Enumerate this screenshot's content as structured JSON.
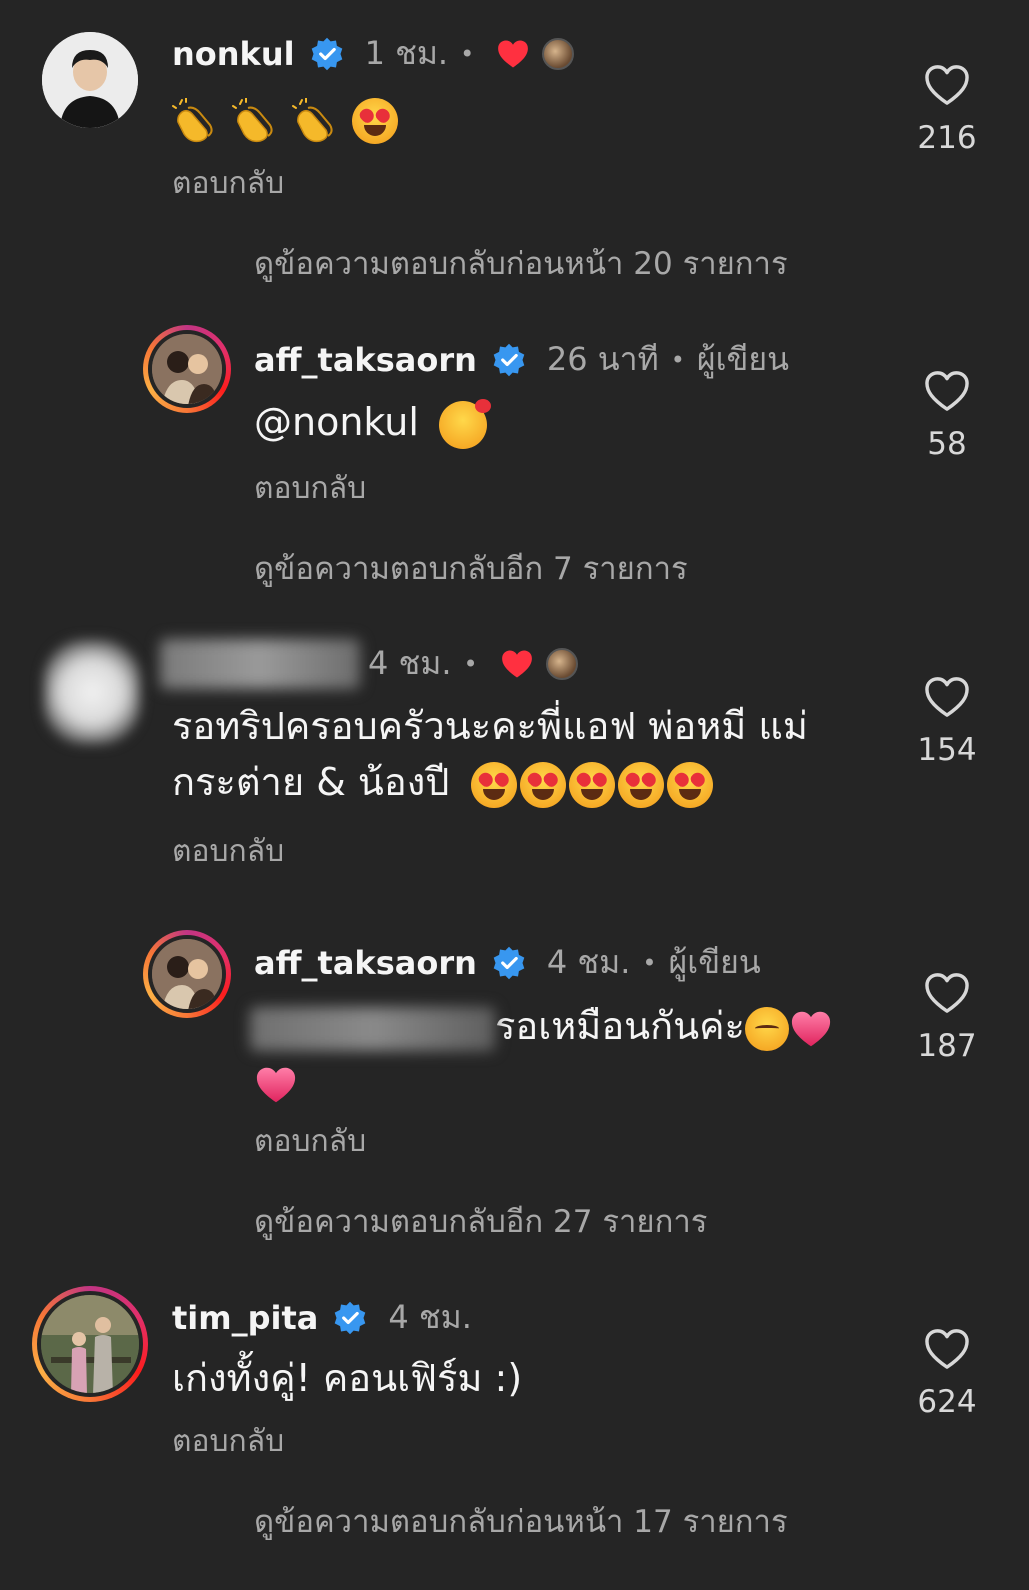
{
  "colors": {
    "background": "#252525",
    "text_primary": "#f5f5f5",
    "text_secondary": "#a8a8a8",
    "verified_blue": "#3897f0",
    "heart_red": "#ff3040"
  },
  "comments": [
    {
      "username": "nonkul",
      "verified": true,
      "time": "1 ชม.",
      "separator": "•",
      "liked_by_author": true,
      "text_emojis": [
        "clapping-hands",
        "clapping-hands",
        "clapping-hands",
        "heart-eyes"
      ],
      "reply_label": "ตอบกลับ",
      "likes": "216",
      "view_more": "ดูข้อความตอบกลับก่อนหน้า 20 รายการ"
    },
    {
      "username": "aff_taksaorn",
      "verified": true,
      "time": "26 นาที",
      "separator": "•",
      "author_tag": "ผู้เขียน",
      "text": "@nonkul",
      "text_emoji": "smiling-face-with-hearts",
      "reply_label": "ตอบกลับ",
      "likes": "58",
      "view_more": "ดูข้อความตอบกลับอีก 7 รายการ"
    },
    {
      "username_hidden": true,
      "time": "4 ชม.",
      "separator": "•",
      "liked_by_author": true,
      "text_line1": "รอทริปครอบครัวนะคะพี่แอฟ พ่อหมี แม่",
      "text_line2": "กระต่าย & น้องปี",
      "text_emojis": [
        "heart-eyes",
        "heart-eyes",
        "heart-eyes",
        "heart-eyes",
        "heart-eyes"
      ],
      "reply_label": "ตอบกลับ",
      "likes": "154"
    },
    {
      "username": "aff_taksaorn",
      "verified": true,
      "time": "4 ชม.",
      "separator": "•",
      "author_tag": "ผู้เขียน",
      "mention_hidden": true,
      "text": "รอเหมือนกันค่ะ",
      "text_emojis": [
        "relieved-face",
        "pink-heart",
        "pink-heart"
      ],
      "reply_label": "ตอบกลับ",
      "likes": "187",
      "view_more": "ดูข้อความตอบกลับอีก 27 รายการ"
    },
    {
      "username": "tim_pita",
      "verified": true,
      "time": "4 ชม.",
      "text": "เก่งทั้งคู่! คอนเฟิร์ม :)",
      "reply_label": "ตอบกลับ",
      "likes": "624",
      "view_more": "ดูข้อความตอบกลับก่อนหน้า 17 รายการ"
    }
  ]
}
